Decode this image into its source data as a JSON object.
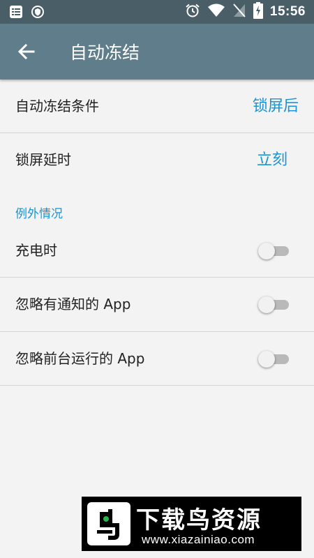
{
  "status_bar": {
    "time": "15:56",
    "icons_left": [
      "notes-icon",
      "shield-icon"
    ],
    "icons_right": [
      "alarm-icon",
      "wifi-icon",
      "no-sim-icon",
      "battery-charging-icon"
    ]
  },
  "app_bar": {
    "title": "自动冻结",
    "back_icon": "arrow-left-icon"
  },
  "settings": {
    "freeze_condition": {
      "label": "自动冻结条件",
      "value": "锁屏后"
    },
    "lock_delay": {
      "label": "锁屏延时",
      "value": "立刻"
    }
  },
  "exceptions": {
    "header": "例外情况",
    "items": [
      {
        "label": "充电时",
        "enabled": false
      },
      {
        "label": "忽略有通知的 App",
        "enabled": false
      },
      {
        "label": "忽略前台运行的 App",
        "enabled": false
      }
    ]
  },
  "watermark": {
    "title": "下载鸟资源",
    "url": "www.xiazainiao.com"
  },
  "colors": {
    "status_bar": "#4a5e68",
    "app_bar": "#607d8b",
    "accent": "#1a94d2",
    "background": "#f3f3f3"
  }
}
